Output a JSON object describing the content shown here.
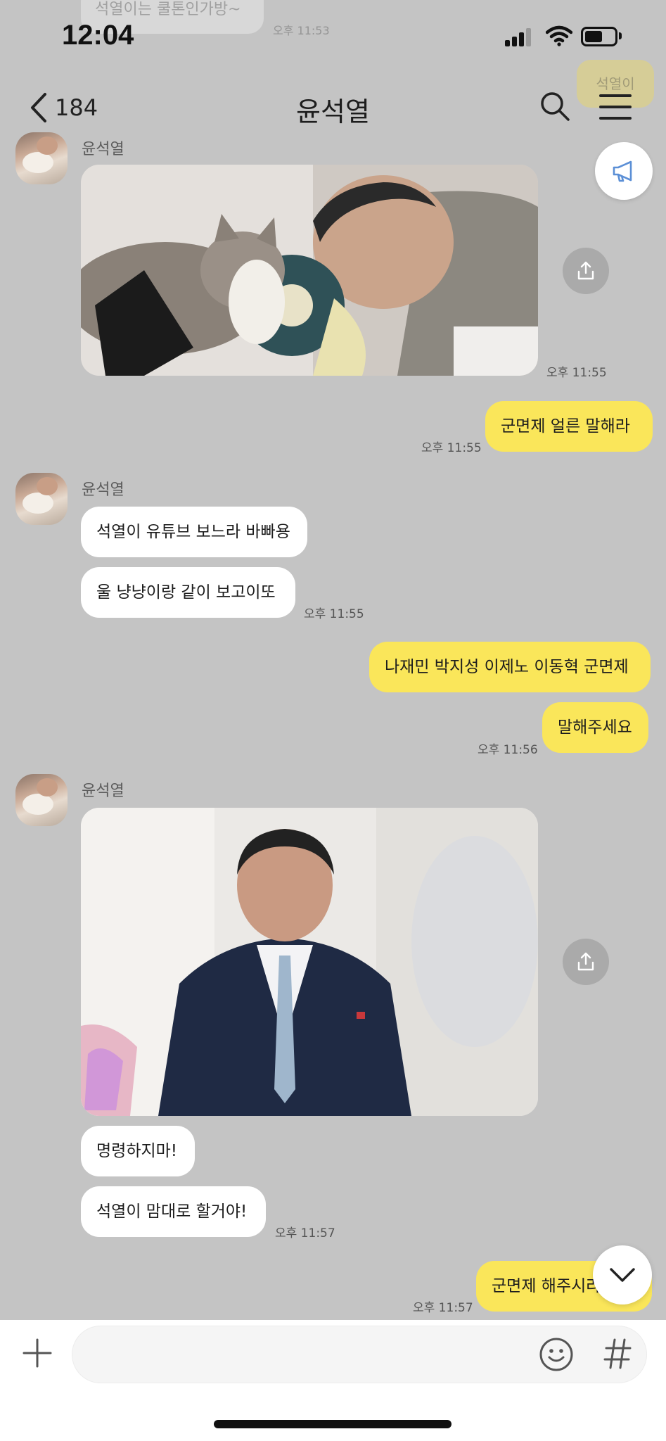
{
  "ghost": {
    "message": "석열이는 쿨톤인가방~",
    "time": "오후 11:53",
    "reply": "석열이"
  },
  "status_bar": {
    "time": "12:04"
  },
  "header": {
    "back_count": "184",
    "title": "윤석열"
  },
  "messages": {
    "group1": {
      "sender": "윤석열",
      "time": "오후 11:55"
    },
    "me1": {
      "text": "군면제 얼른 말해라",
      "time": "오후 11:55"
    },
    "group2": {
      "sender": "윤석열",
      "lines": [
        "석열이 유튜브 보느라 바빠용",
        "울 냥냥이랑 같이 보고이또"
      ],
      "time": "오후 11:55"
    },
    "me2": {
      "lines": [
        "나재민 박지성 이제노 이동혁 군면제",
        "말해주세요"
      ],
      "time": "오후 11:56"
    },
    "group3": {
      "sender": "윤석열",
      "lines": [
        "명령하지마!",
        "석열이 맘대로 할거야!"
      ],
      "time": "오후 11:57"
    },
    "me3": {
      "text": "군면제 해주시라고요",
      "time": "오후 11:57"
    }
  },
  "input": {
    "placeholder": ""
  },
  "colors": {
    "background": "#c4c4c4",
    "my_bubble": "#fae65a",
    "their_bubble": "#ffffff"
  },
  "icons": [
    "back-icon",
    "search-icon",
    "menu-icon",
    "megaphone-icon",
    "share-icon",
    "chevron-down-icon",
    "plus-icon",
    "emoji-icon",
    "hashtag-icon"
  ]
}
